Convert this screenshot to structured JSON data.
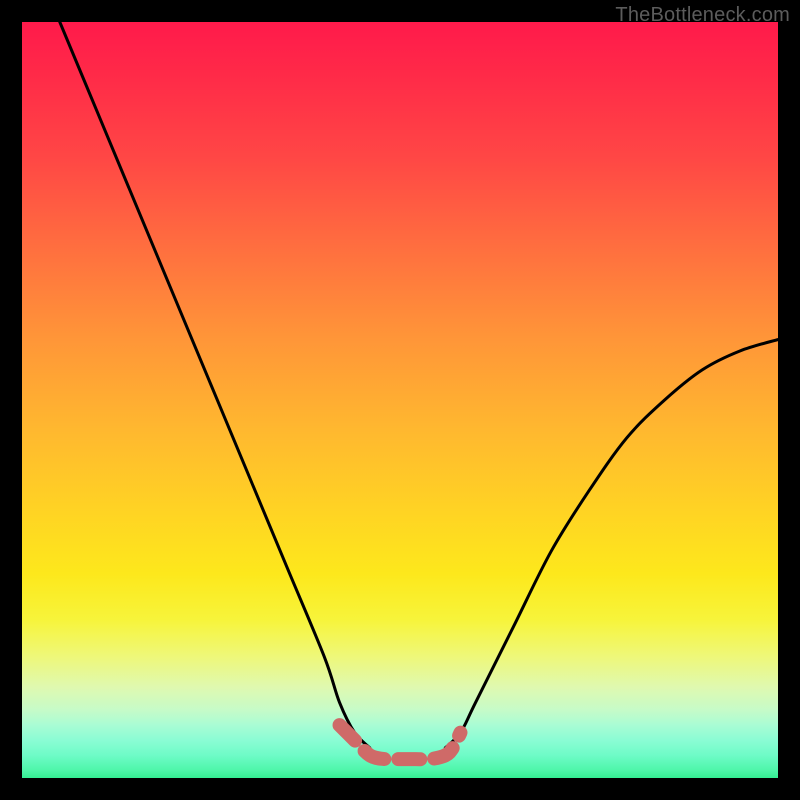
{
  "watermark": "TheBottleneck.com",
  "chart_data": {
    "type": "line",
    "title": "",
    "xlabel": "",
    "ylabel": "",
    "xlim": [
      0,
      100
    ],
    "ylim": [
      0,
      100
    ],
    "series": [
      {
        "name": "left-curve",
        "x": [
          5,
          10,
          15,
          20,
          25,
          30,
          35,
          40,
          42,
          44,
          46
        ],
        "y": [
          100,
          88,
          76,
          64,
          52,
          40,
          28,
          16,
          10,
          6,
          4
        ]
      },
      {
        "name": "right-curve",
        "x": [
          56,
          58,
          60,
          65,
          70,
          75,
          80,
          85,
          90,
          95,
          100
        ],
        "y": [
          4,
          6,
          10,
          20,
          30,
          38,
          45,
          50,
          54,
          56.5,
          58
        ]
      },
      {
        "name": "bottom-highlight",
        "x": [
          42,
          44,
          46,
          48,
          50,
          52,
          54,
          56,
          57,
          58
        ],
        "y": [
          7,
          5,
          3,
          2.5,
          2.5,
          2.5,
          2.5,
          3,
          4,
          6
        ]
      }
    ],
    "colors": {
      "curve": "#000000",
      "highlight": "#cf6a68",
      "gradient_top": "#ff1a4b",
      "gradient_bottom": "#34ef92"
    }
  }
}
